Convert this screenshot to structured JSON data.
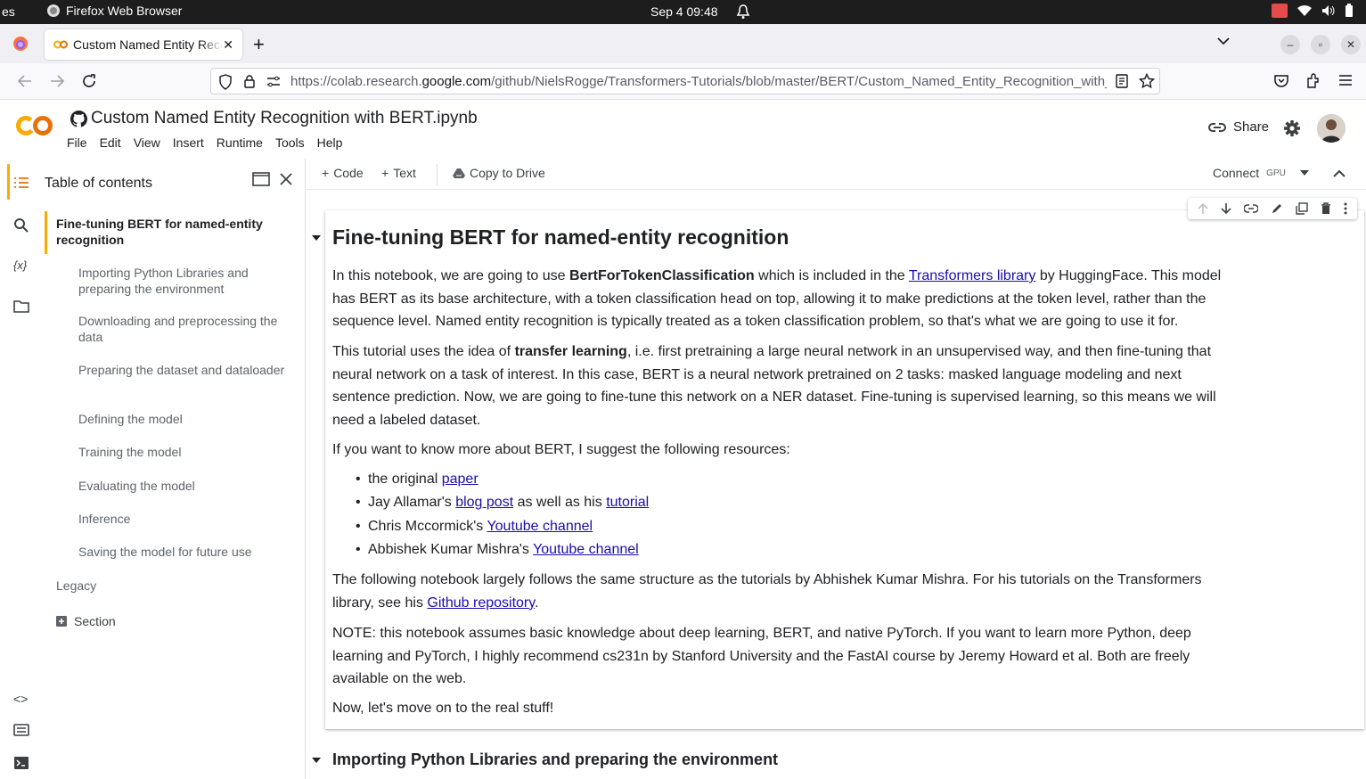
{
  "os": {
    "left_fragment": "es",
    "app_name": "Firefox Web Browser",
    "clock": "Sep 4  09:48"
  },
  "browser": {
    "tab_title": "Custom Named Entity Recognition",
    "url_prefix": "https://colab.research.",
    "url_domain": "google.com",
    "url_path": "/github/NielsRogge/Transformers-Tutorials/blob/master/BERT/Custom_Named_Entity_Recognition_with_BERT.ipynb"
  },
  "colab": {
    "notebook_title": "Custom Named Entity Recognition with BERT.ipynb",
    "menu": [
      "File",
      "Edit",
      "View",
      "Insert",
      "Runtime",
      "Tools",
      "Help"
    ],
    "share_label": "Share"
  },
  "sidebar": {
    "title": "Table of contents",
    "items": [
      {
        "label": "Fine-tuning BERT for named-entity recognition",
        "level": 1,
        "active": true
      },
      {
        "label": "Importing Python Libraries and preparing the environment",
        "level": 2
      },
      {
        "label": "Downloading and preprocessing the data",
        "level": 2
      },
      {
        "label": "Preparing the dataset and dataloader",
        "level": 2
      },
      {
        "label": "Defining the model",
        "level": 2
      },
      {
        "label": "Training the model",
        "level": 2
      },
      {
        "label": "Evaluating the model",
        "level": 2
      },
      {
        "label": "Inference",
        "level": 2
      },
      {
        "label": "Saving the model for future use",
        "level": 2
      },
      {
        "label": "Legacy",
        "level": 1
      },
      {
        "label": "Section",
        "level": 1
      }
    ]
  },
  "toolbar": {
    "code_label": "Code",
    "text_label": "Text",
    "copy_label": "Copy to Drive",
    "connect_label": "Connect",
    "gpu_label": "GPU"
  },
  "cell": {
    "heading": "Fine-tuning BERT for named-entity recognition",
    "p1_a": "In this notebook, we are going to use ",
    "p1_b": "BertForTokenClassification",
    "p1_c": " which is included in the ",
    "p1_link": "Transformers library",
    "p1_d": " by HuggingFace. This model has BERT as its base architecture, with a token classification head on top, allowing it to make predictions at the token level, rather than the sequence level. Named entity recognition is typically treated as a token classification problem, so that's what we are going to use it for.",
    "p2_a": "This tutorial uses the idea of ",
    "p2_b": "transfer learning",
    "p2_c": ", i.e. first pretraining a large neural network in an unsupervised way, and then fine-tuning that neural network on a task of interest. In this case, BERT is a neural network pretrained on 2 tasks: masked language modeling and next sentence prediction. Now, we are going to fine-tune this network on a NER dataset. Fine-tuning is supervised learning, so this means we will need a labeled dataset.",
    "p3": "If you want to know more about BERT, I suggest the following resources:",
    "li1_a": "the original ",
    "li1_link": "paper",
    "li2_a": "Jay Allamar's ",
    "li2_link1": "blog post",
    "li2_b": " as well as his ",
    "li2_link2": "tutorial",
    "li3_a": "Chris Mccormick's ",
    "li3_link": "Youtube channel",
    "li4_a": "Abbishek Kumar Mishra's ",
    "li4_link": "Youtube channel",
    "p4_a": "The following notebook largely follows the same structure as the tutorials by Abhishek Kumar Mishra. For his tutorials on the Transformers library, see his ",
    "p4_link": "Github repository",
    "p4_b": ".",
    "p5": "NOTE: this notebook assumes basic knowledge about deep learning, BERT, and native PyTorch. If you want to learn more Python, deep learning and PyTorch, I highly recommend cs231n by Stanford University and the FastAI course by Jeremy Howard et al. Both are freely available on the web.",
    "p6": "Now, let's move on to the real stuff!"
  },
  "next_section": "Importing Python Libraries and preparing the environment",
  "colors": {
    "accent_orange": "#f9ab00",
    "link": "#1a0dab",
    "os_bar": "#1d1d1d"
  }
}
